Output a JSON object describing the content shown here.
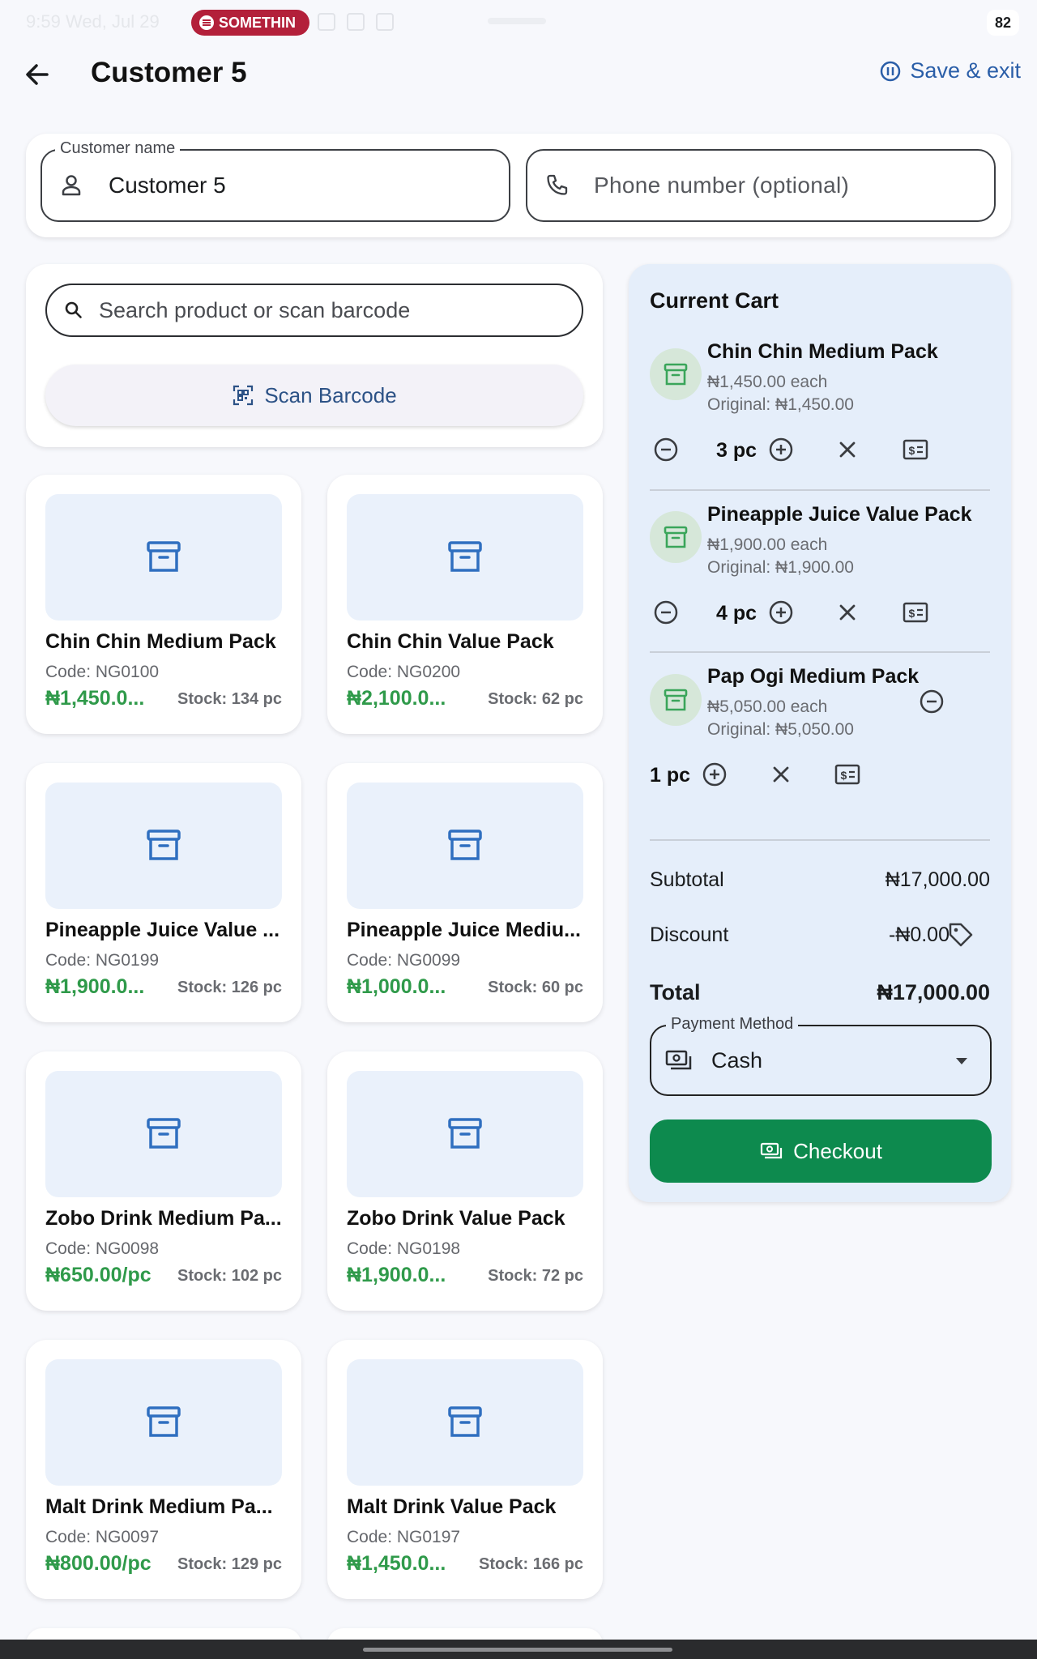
{
  "status_bar": {
    "time": "9:59",
    "date": "Wed, Jul 29",
    "media_pill": "SOMETHIN",
    "battery": "82"
  },
  "header": {
    "title": "Customer 5",
    "save_exit": "Save & exit",
    "icons": {
      "back": "arrow-left-icon",
      "save": "pause-circle-icon"
    }
  },
  "customer": {
    "name_label": "Customer name",
    "name_value": "Customer 5",
    "phone_placeholder": "Phone number (optional)"
  },
  "search": {
    "placeholder": "Search product or scan barcode",
    "scan_label": "Scan Barcode"
  },
  "products": [
    {
      "name": "Chin Chin Medium Pack",
      "code": "Code: NG0100",
      "price": "₦1,450.0...",
      "stock": "Stock: 134 pc"
    },
    {
      "name": "Chin Chin Value Pack",
      "code": "Code: NG0200",
      "price": "₦2,100.0...",
      "stock": "Stock: 62 pc"
    },
    {
      "name": "Pineapple Juice Value ...",
      "code": "Code: NG0199",
      "price": "₦1,900.0...",
      "stock": "Stock: 126 pc"
    },
    {
      "name": "Pineapple Juice Mediu...",
      "code": "Code: NG0099",
      "price": "₦1,000.0...",
      "stock": "Stock: 60 pc"
    },
    {
      "name": "Zobo Drink Medium Pa...",
      "code": "Code: NG0098",
      "price": "₦650.00/pc",
      "stock": "Stock: 102 pc"
    },
    {
      "name": "Zobo Drink Value Pack",
      "code": "Code: NG0198",
      "price": "₦1,900.0...",
      "stock": "Stock: 72 pc"
    },
    {
      "name": "Malt Drink Medium Pa...",
      "code": "Code: NG0097",
      "price": "₦800.00/pc",
      "stock": "Stock: 129 pc"
    },
    {
      "name": "Malt Drink Value Pack",
      "code": "Code: NG0197",
      "price": "₦1,450.0...",
      "stock": "Stock: 166 pc"
    }
  ],
  "cart": {
    "title": "Current Cart",
    "items": [
      {
        "name": "Chin Chin Medium Pack",
        "each": "₦1,450.00 each",
        "original": "Original: ₦1,450.00",
        "qty": "3 pc"
      },
      {
        "name": "Pineapple Juice Value Pack",
        "each": "₦1,900.00 each",
        "original": "Original: ₦1,900.00",
        "qty": "4 pc"
      },
      {
        "name": "Pap Ogi Medium Pack",
        "each": "₦5,050.00 each",
        "original": "Original: ₦5,050.00",
        "qty": "1 pc"
      }
    ],
    "subtotal_label": "Subtotal",
    "subtotal_value": "₦17,000.00",
    "discount_label": "Discount",
    "discount_value": "-₦0.00",
    "total_label": "Total",
    "total_value": "₦17,000.00",
    "payment_label": "Payment Method",
    "payment_value": "Cash",
    "checkout_label": "Checkout"
  },
  "colors": {
    "accent_blue": "#2a5ea8",
    "price_green": "#2f9a4a",
    "checkout_green": "#0d8a4e",
    "cart_bg": "#e5eefa"
  }
}
